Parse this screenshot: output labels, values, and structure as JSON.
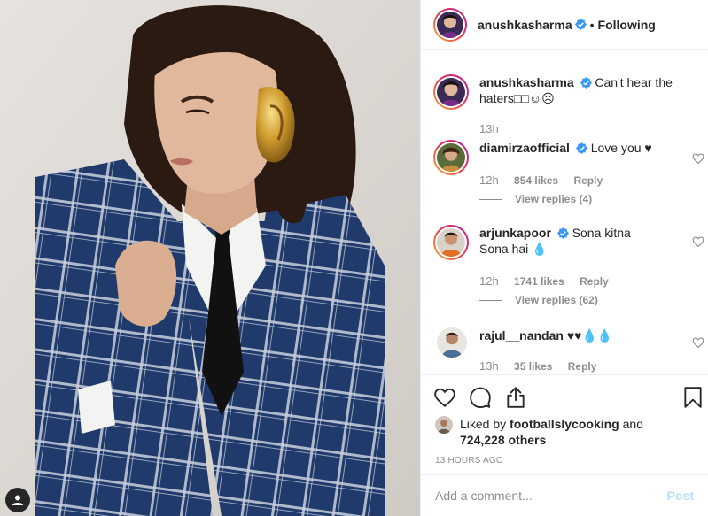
{
  "post": {
    "author": "anushkasharma",
    "follow_state": "Following",
    "dot": "•"
  },
  "icons": {
    "verified": "verified-badge-icon",
    "like": "heart-icon",
    "comment": "comment-icon",
    "share": "share-icon",
    "save": "bookmark-icon",
    "profile": "profile-icon"
  },
  "colors": {
    "verified_blue": "#3897f0",
    "post_button": "#b2dffc",
    "muted": "#8e8e8e"
  },
  "comments": [
    {
      "user": "anushkasharma",
      "text": "Can't hear the haters□□☺☹",
      "time": "13h",
      "verified": true
    },
    {
      "user": "diamirzaofficial",
      "text": "Love you ♥",
      "time": "12h",
      "likes": "854 likes",
      "reply": "Reply",
      "view_replies": "View replies (4)",
      "verified": true
    },
    {
      "user": "arjunkapoor",
      "text": "Sona kitna Sona hai 💧",
      "time": "12h",
      "likes": "1741 likes",
      "reply": "Reply",
      "view_replies": "View replies (62)",
      "verified": true
    },
    {
      "user": "rajul__nandan",
      "text": "♥♥💧💧",
      "time": "13h",
      "likes": "35 likes",
      "reply": "Reply",
      "verified": false
    }
  ],
  "likes_summary": {
    "prefix": "Liked by",
    "user": "footballslycooking",
    "and": "and",
    "count": "724,228 others"
  },
  "timestamp": "13 HOURS AGO",
  "add_comment": {
    "placeholder": "Add a comment...",
    "post_label": "Post"
  }
}
